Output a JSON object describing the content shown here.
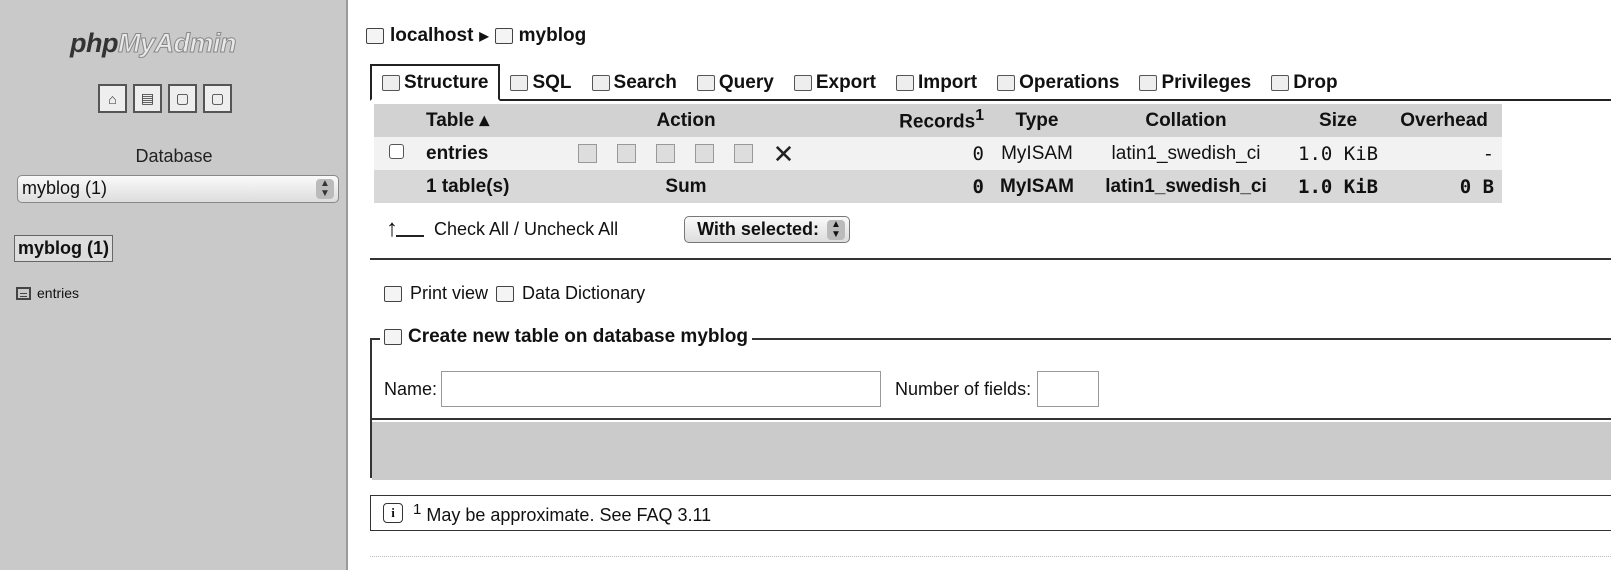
{
  "sidebar": {
    "logo_php": "php",
    "logo_myadmin": "MyAdmin",
    "database_label": "Database",
    "database_select": "myblog (1)",
    "db_heading": "myblog (1)",
    "tables": [
      {
        "label": "entries"
      }
    ]
  },
  "breadcrumb": {
    "server": "localhost",
    "database": "myblog"
  },
  "tabs": [
    "Structure",
    "SQL",
    "Search",
    "Query",
    "Export",
    "Import",
    "Operations",
    "Privileges",
    "Drop"
  ],
  "table": {
    "headers": {
      "table": "Table",
      "action": "Action",
      "records": "Records",
      "records_sup": "1",
      "type": "Type",
      "collation": "Collation",
      "size": "Size",
      "overhead": "Overhead"
    },
    "rows": [
      {
        "name": "entries",
        "records": "0",
        "type": "MyISAM",
        "collation": "latin1_swedish_ci",
        "size": "1.0 KiB",
        "overhead": "-"
      }
    ],
    "sum": {
      "name": "1 table(s)",
      "label": "Sum",
      "records": "0",
      "type": "MyISAM",
      "collation": "latin1_swedish_ci",
      "size": "1.0 KiB",
      "overhead": "0 B"
    }
  },
  "check_all": "Check All / Uncheck All",
  "with_selected": "With selected:",
  "links": {
    "print_view": "Print view",
    "data_dictionary": "Data Dictionary"
  },
  "create": {
    "legend": "Create new table on database myblog",
    "name_label": "Name:",
    "fields_label": "Number of fields:"
  },
  "note": {
    "sup": "1",
    "text": "May be approximate. See FAQ 3.11"
  }
}
